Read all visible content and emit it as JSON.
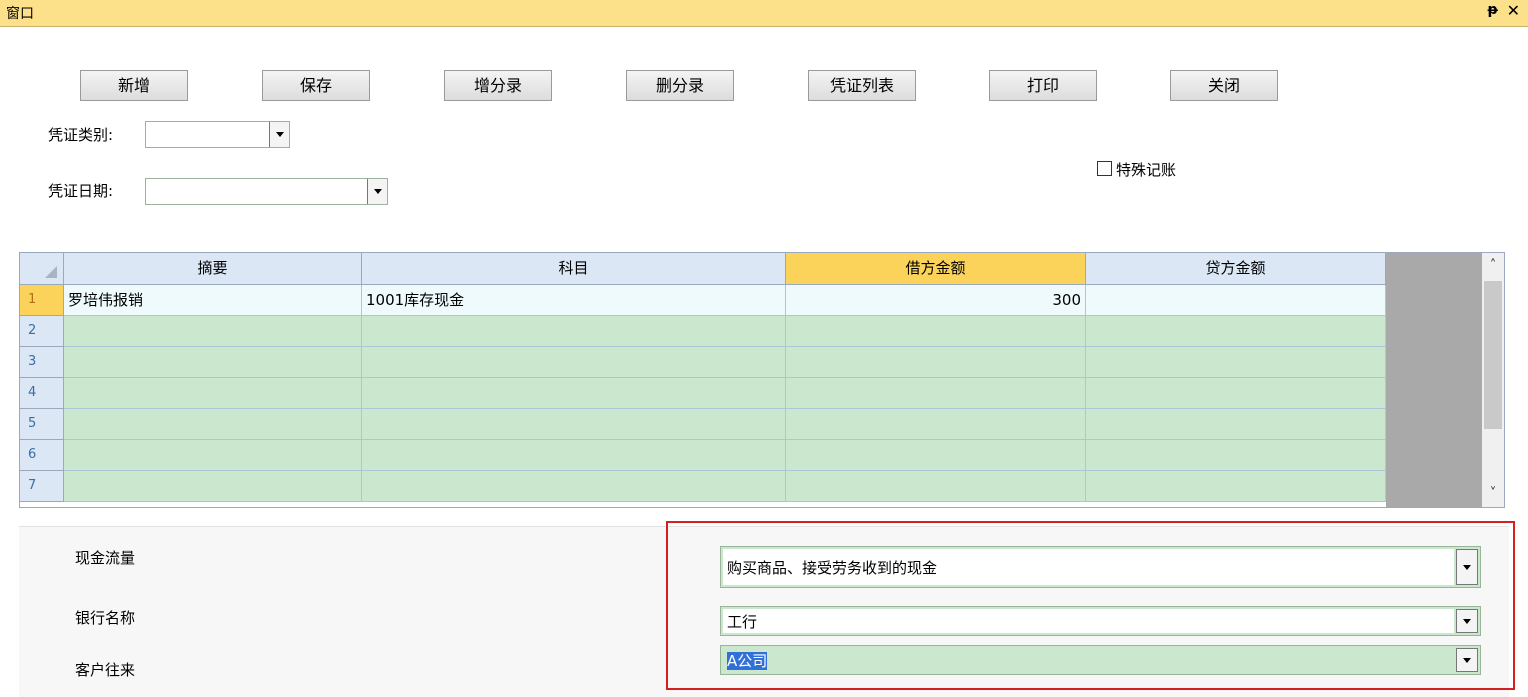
{
  "window": {
    "title": "窗口",
    "pin_glyph": "ᵽ",
    "close_glyph": "✕"
  },
  "toolbar": {
    "buttons": [
      "新增",
      "保存",
      "增分录",
      "删分录",
      "凭证列表",
      "打印",
      "关闭"
    ]
  },
  "form": {
    "voucher_type_label": "凭证类别:",
    "voucher_type_value": "",
    "voucher_date_label": "凭证日期:",
    "voucher_date_value": "",
    "special_label": "特殊记账",
    "special_checked": false
  },
  "grid": {
    "columns": [
      "摘要",
      "科目",
      "借方金额",
      "贷方金额"
    ],
    "row_numbers": [
      "1",
      "2",
      "3",
      "4",
      "5",
      "6",
      "7"
    ],
    "rows": [
      [
        "罗培伟报销",
        "1001库存现金",
        "300",
        ""
      ],
      [
        "",
        "",
        "",
        ""
      ],
      [
        "",
        "",
        "",
        ""
      ],
      [
        "",
        "",
        "",
        ""
      ],
      [
        "",
        "",
        "",
        ""
      ],
      [
        "",
        "",
        "",
        ""
      ],
      [
        "",
        "",
        "",
        ""
      ]
    ],
    "scroll_up": "˄",
    "scroll_down": "˅"
  },
  "details": {
    "cash_flow_label": "现金流量",
    "cash_flow_value": "购买商品、接受劳务收到的现金",
    "bank_label": "银行名称",
    "bank_value": "工行",
    "customer_label": "客户往来",
    "customer_value": "A公司"
  }
}
